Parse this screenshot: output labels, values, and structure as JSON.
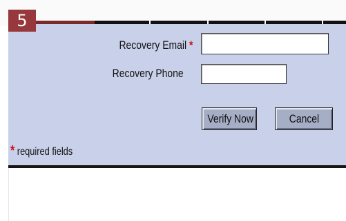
{
  "step": {
    "number": "5"
  },
  "form": {
    "email_label": "Recovery Email",
    "phone_label": "Recovery Phone",
    "required_marker": "*",
    "email_value": "",
    "phone_value": ""
  },
  "buttons": {
    "verify_label": "Verify Now",
    "cancel_label": "Cancel"
  },
  "footer": {
    "required_note": "required fields"
  },
  "colors": {
    "panel_bg": "#c9d0ea",
    "badge_bg": "#97383d",
    "required_star": "#cc1111",
    "button_bg": "#a6aec6"
  }
}
